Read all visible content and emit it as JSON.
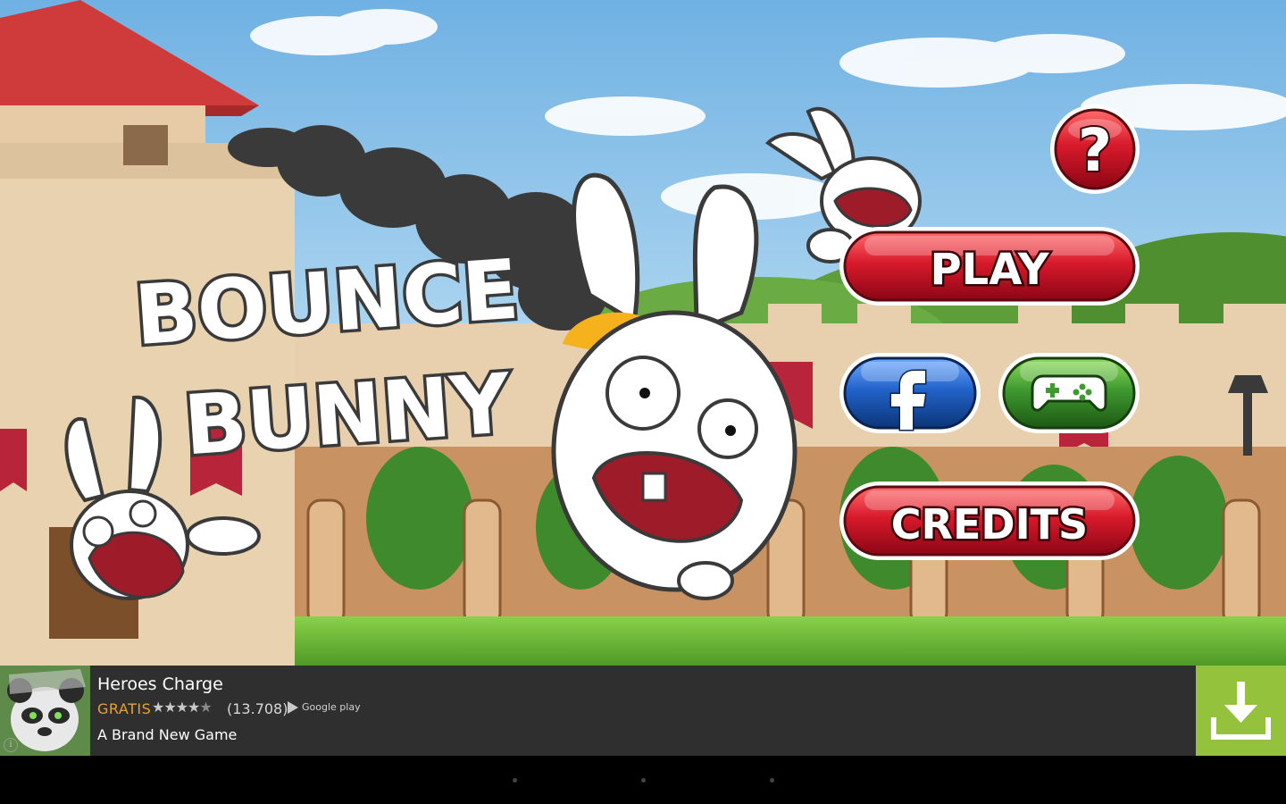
{
  "game": {
    "title_line1": "BOUNCE",
    "title_line2": "BUNNY",
    "buttons": {
      "help": "?",
      "play": "PLAY",
      "credits": "CREDITS"
    }
  },
  "ad": {
    "title": "Heroes Charge",
    "price": "GRATIS",
    "rating": 4,
    "rating_stars": "★★★★★",
    "review_count": "(13.708)",
    "store_label": "Google play",
    "subtitle": "A Brand New Game",
    "info_label": "i",
    "accent_color": "#95c23d",
    "price_color": "#e9a035"
  },
  "colors": {
    "sky": "#8fc4e8",
    "button_red": "#c8102e",
    "button_blue": "#1f5fb4",
    "button_green": "#3f9a2f"
  }
}
